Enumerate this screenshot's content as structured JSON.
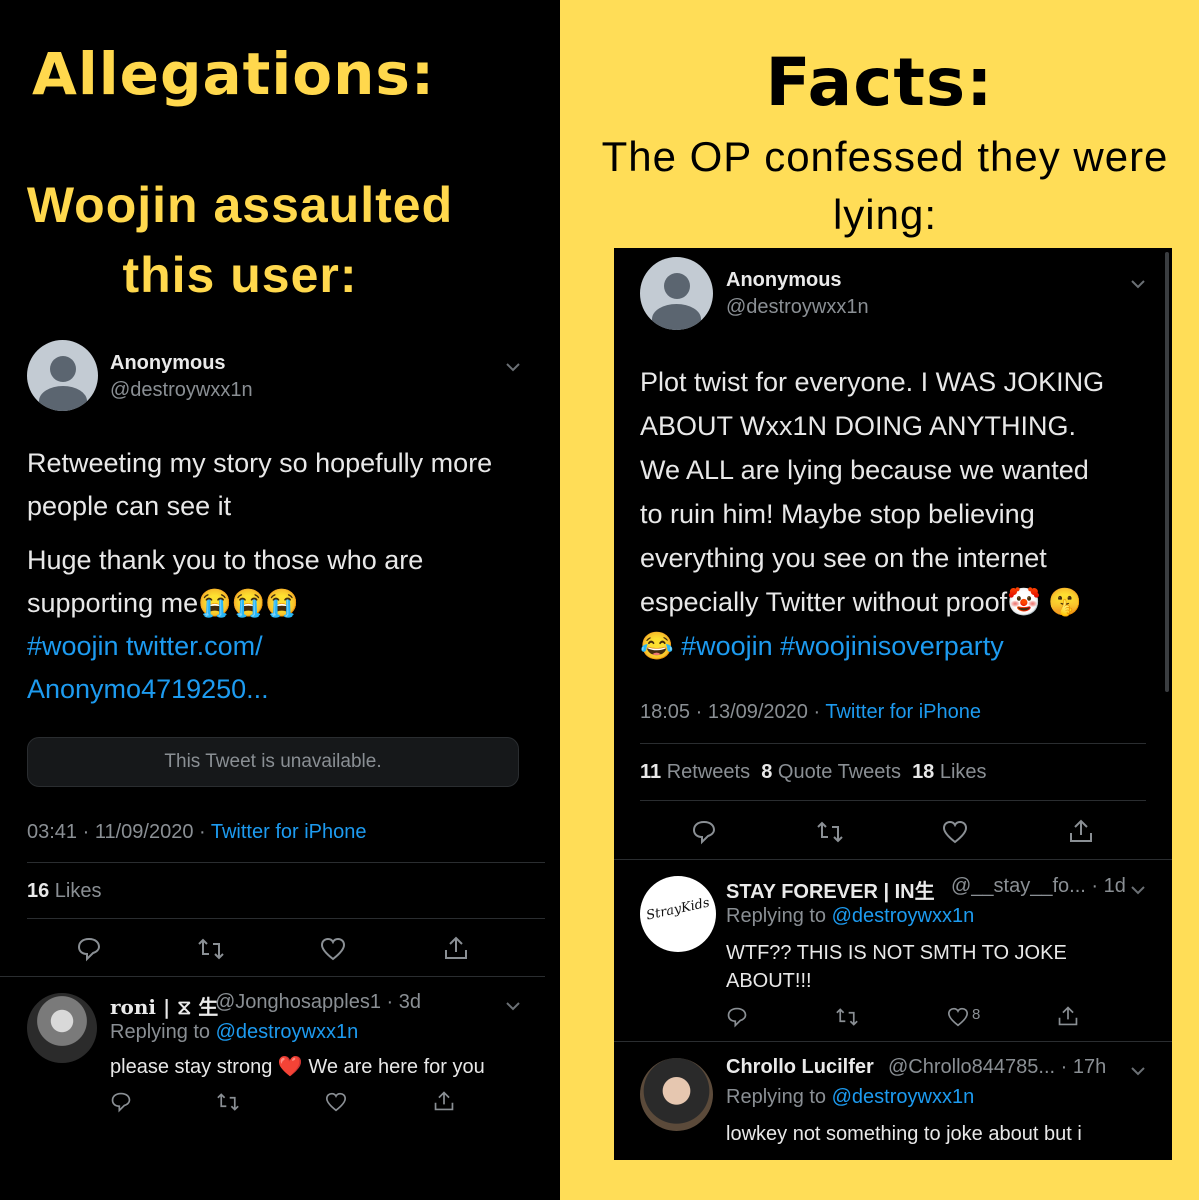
{
  "left": {
    "title": "Allegations:",
    "subtitle_line1": "Woojin assaulted",
    "subtitle_line2": "this user:",
    "tweet": {
      "name": "Anonymous",
      "handle": "@destroywxx1n",
      "text_line1": "Retweeting my story so hopefully more",
      "text_line2": "people can see it",
      "text_line3": "Huge thank you to those who are",
      "text_line4": "supporting me😭😭😭",
      "link_line1": "#woojin twitter.com/",
      "link_line2": "Anonymo4719250...",
      "unavailable": "This Tweet is unavailable.",
      "time": "03:41 · 11/09/2020 · ",
      "source": "Twitter for iPhone",
      "likes_count": "16",
      "likes_label": " Likes"
    },
    "reply": {
      "name": "roni | ⧖ 生",
      "handle": "@Jonghosapples1 · 3d",
      "replying_prefix": "Replying to ",
      "replying_to": "@destroywxx1n",
      "text": "please stay strong ❤️  We are here for you"
    }
  },
  "right": {
    "title": "Facts:",
    "subtitle_line1": "The OP confessed they were",
    "subtitle_line2": "lying:",
    "tweet": {
      "name": "Anonymous",
      "handle": "@destroywxx1n",
      "line1": "Plot twist for everyone. I WAS JOKING",
      "line2": "ABOUT Wxx1N DOING ANYTHING.",
      "line3": "We ALL are lying because we wanted",
      "line4": "to ruin him! Maybe stop believing",
      "line5": "everything you see on the internet",
      "line6": "especially Twitter without proof🤡 🤫",
      "line7_emoji": "😂 ",
      "line7_tags": "#woojin #woojinisoverparty",
      "time": "18:05 · 13/09/2020 · ",
      "source": "Twitter for iPhone",
      "retweets_count": "11",
      "retweets_label": " Retweets",
      "quotes_count": "8",
      "quotes_label": " Quote Tweets",
      "likes_count": "18",
      "likes_label": " Likes"
    },
    "reply1": {
      "name": "STAY FOREVER | IN生",
      "handle": "@__stay__fo... · 1d",
      "replying_prefix": "Replying to ",
      "replying_to": "@destroywxx1n",
      "text_line1": "WTF?? THIS IS NOT SMTH TO JOKE",
      "text_line2": "ABOUT!!!",
      "like_count": "8",
      "logo_text": "StrayKids"
    },
    "reply2": {
      "name": "Chrollo Lucilfer",
      "handle": "@Chrollo844785... · 17h",
      "replying_prefix": "Replying to ",
      "replying_to": "@destroywxx1n",
      "text": "lowkey not something to joke about but i"
    }
  },
  "colors": {
    "yellow": "#ffdd57",
    "title_yellow": "#ffd84d",
    "link_blue": "#1d9bf0",
    "muted": "#8a8f94"
  }
}
